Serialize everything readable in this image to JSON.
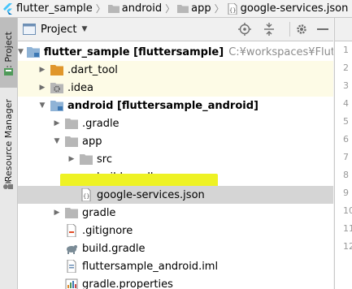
{
  "breadcrumb": [
    {
      "label": "flutter_sample",
      "icon": "flutter-icon"
    },
    {
      "label": "android",
      "icon": "folder-icon"
    },
    {
      "label": "app",
      "icon": "folder-icon"
    },
    {
      "label": "google-services.json",
      "icon": "json-file-icon"
    }
  ],
  "left_stripe": {
    "project_tab": "1: Project",
    "resource_tab": "Resource Manager"
  },
  "project_panel": {
    "view_selector": "Project",
    "header_icons": [
      "locate-icon",
      "collapse-all-icon",
      "settings-icon",
      "hide-icon"
    ]
  },
  "tree": [
    {
      "label": "flutter_sample [fluttersample]",
      "path": "C:¥workspaces¥FlutterProjects¥f",
      "icon": "module-folder-icon",
      "expanded": true,
      "level": 0
    },
    {
      "label": ".dart_tool",
      "icon": "orange-folder-icon",
      "expanded": false,
      "level": 1
    },
    {
      "label": ".idea",
      "icon": "settings-folder-icon",
      "expanded": false,
      "level": 1
    },
    {
      "label": "android [fluttersample_android]",
      "icon": "module-folder-icon",
      "expanded": true,
      "level": 1
    },
    {
      "label": ".gradle",
      "icon": "folder-icon",
      "expanded": false,
      "level": 2
    },
    {
      "label": "app",
      "icon": "folder-icon",
      "expanded": true,
      "level": 2
    },
    {
      "label": "src",
      "icon": "folder-icon",
      "expanded": false,
      "level": 3
    },
    {
      "label": "build.gradle",
      "icon": "gradle-icon",
      "level": 3
    },
    {
      "label": "google-services.json",
      "icon": "json-file-icon",
      "level": 3,
      "selected": true
    },
    {
      "label": "gradle",
      "icon": "folder-icon",
      "expanded": false,
      "level": 2
    },
    {
      "label": ".gitignore",
      "icon": "gitignore-icon",
      "level": 2
    },
    {
      "label": "build.gradle",
      "icon": "gradle-icon",
      "level": 2
    },
    {
      "label": "fluttersample_android.iml",
      "icon": "iml-file-icon",
      "level": 2
    },
    {
      "label": "gradle.properties",
      "icon": "properties-icon",
      "level": 2
    }
  ],
  "editor": {
    "line_numbers": [
      "1",
      "2",
      "3",
      "4",
      "5",
      "6",
      "7",
      "8",
      "9",
      "10",
      "11",
      "12"
    ]
  },
  "colors": {
    "selection": "#d5d5d5",
    "highlight_marker": "#eef224",
    "row_highlight": "#fdfbe6",
    "folder_blue": "#8fb3d6",
    "folder_orange": "#e0962a",
    "gradle_gray": "#7a8b96"
  }
}
